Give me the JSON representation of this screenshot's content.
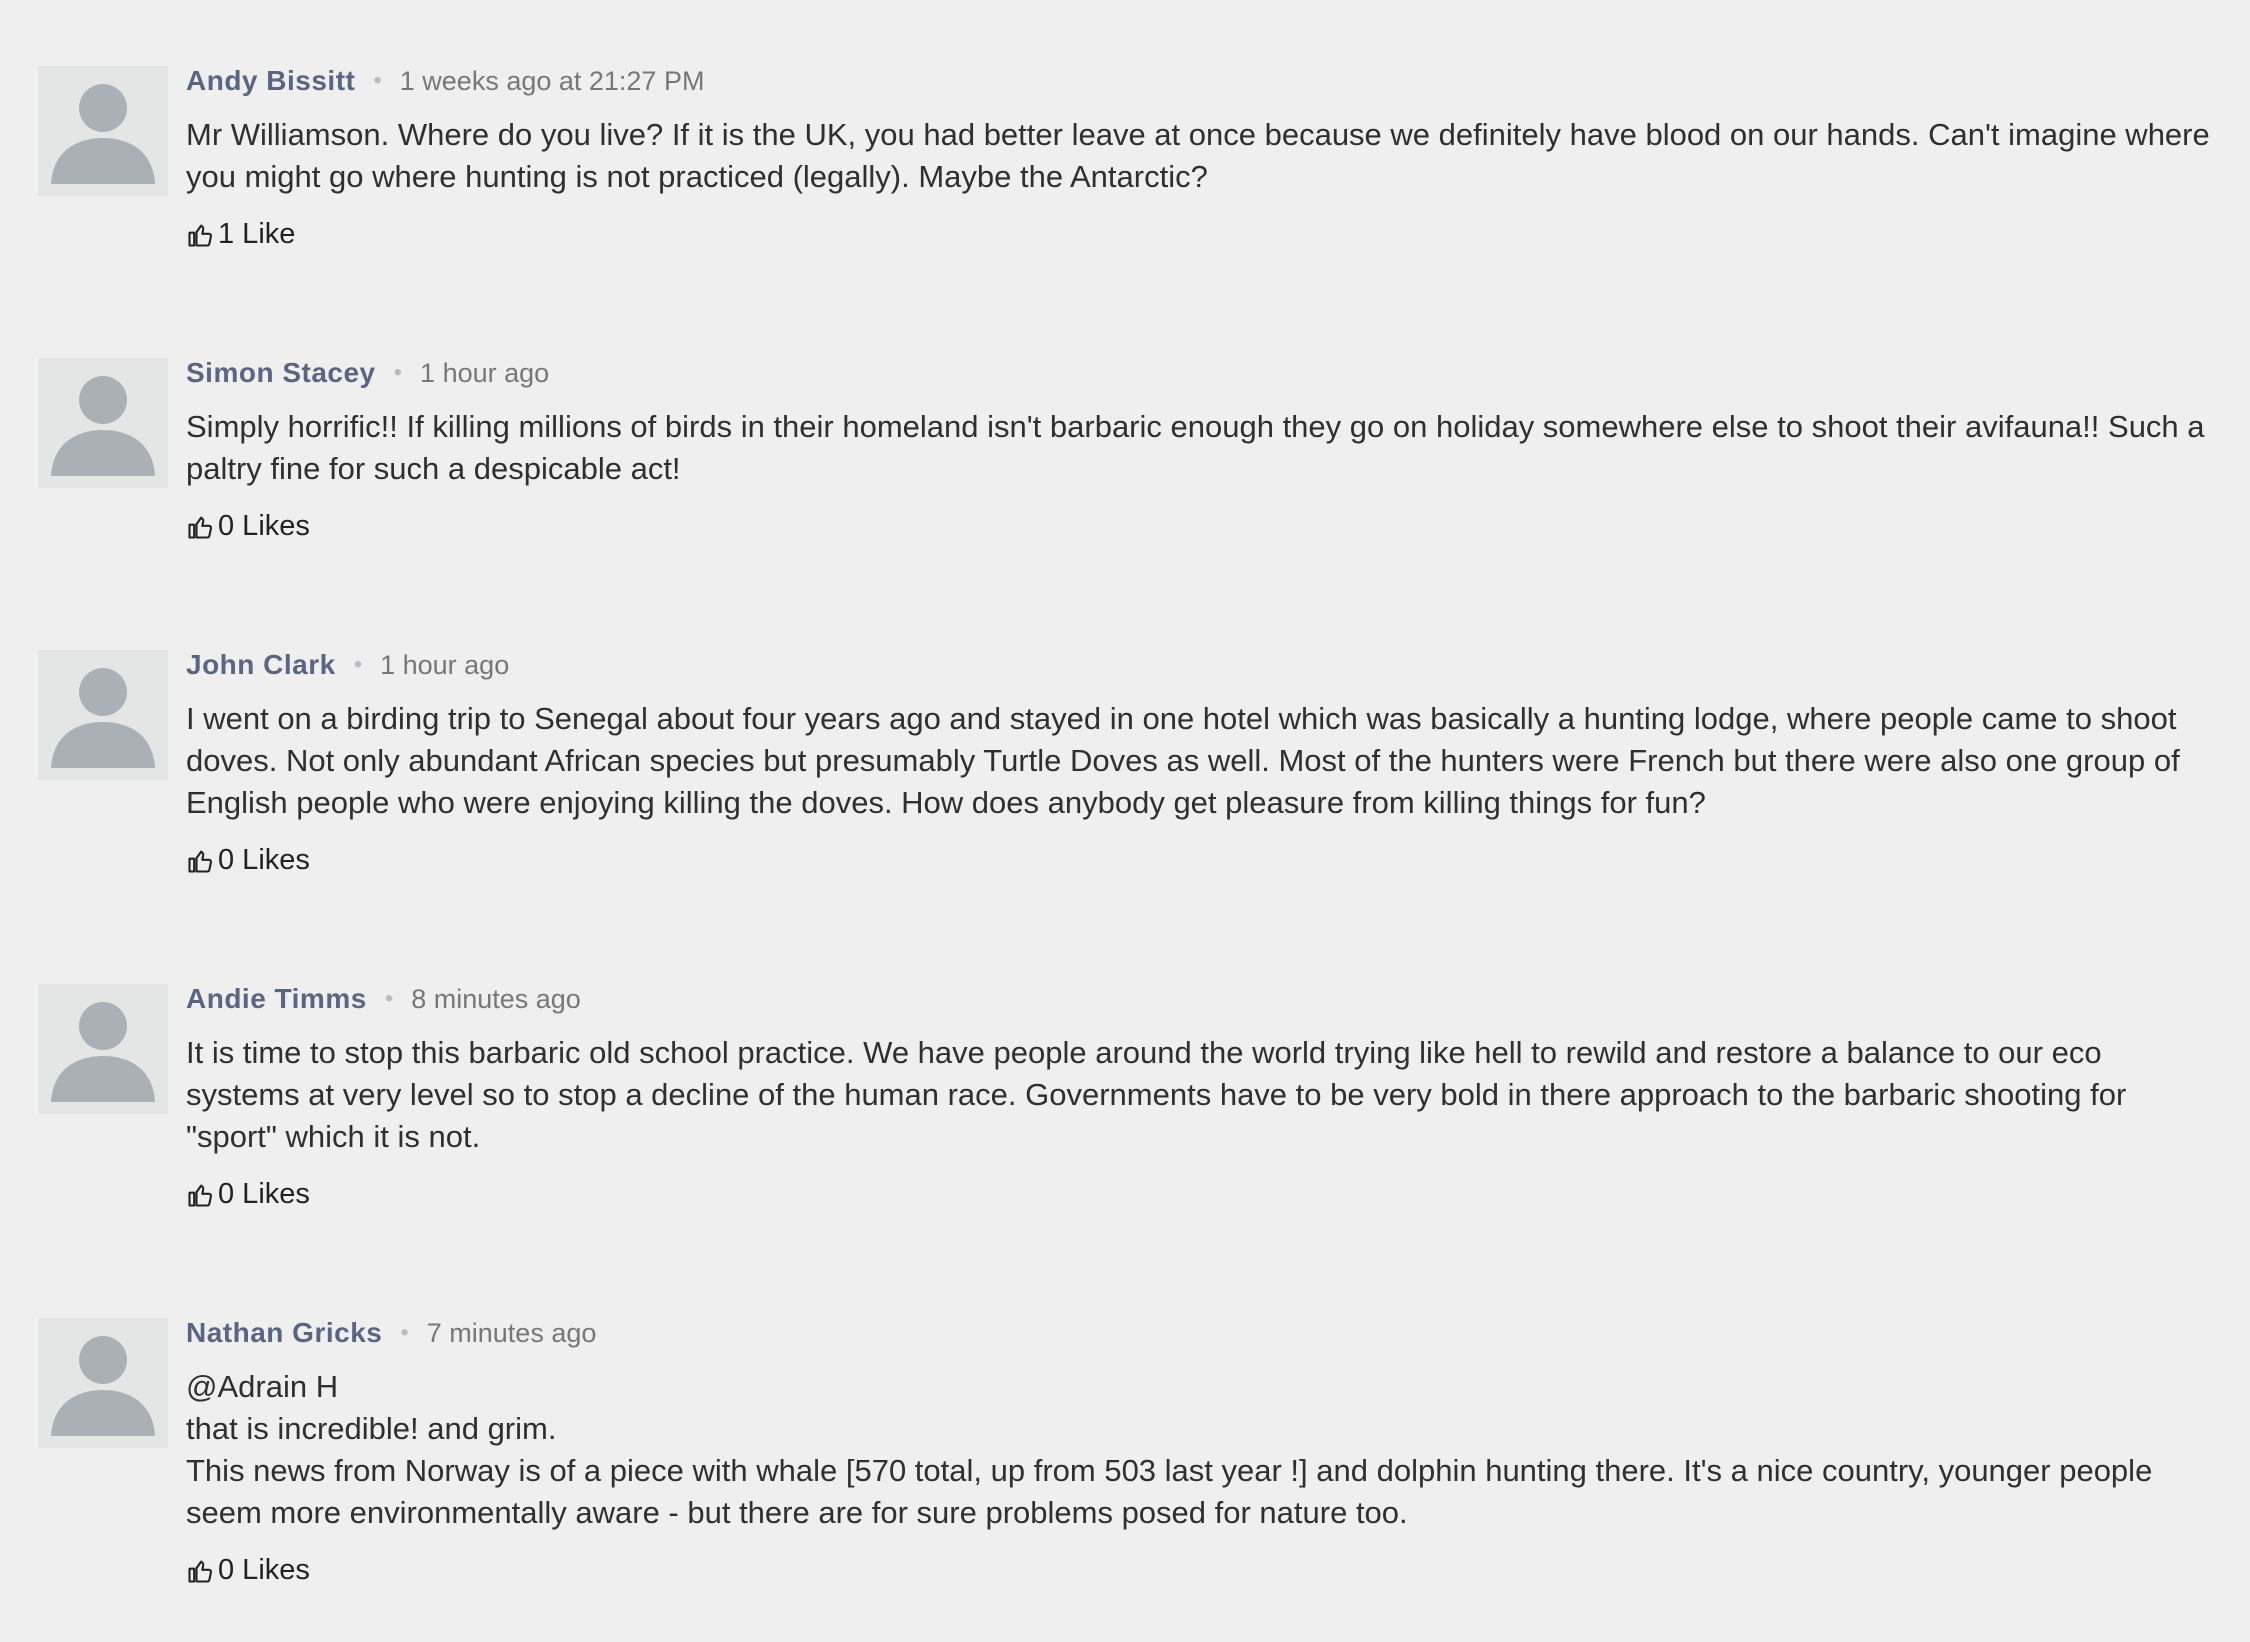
{
  "comments": [
    {
      "author": "Andy Bissitt",
      "separator": "•",
      "time": "1 weeks ago at 21:27 PM",
      "lines": [
        "Mr Williamson. Where do you live? If it is the UK, you had better leave at once because we definitely have blood on our hands. Can't imagine where you might go where  hunting is not practiced (legally). Maybe the Antarctic?"
      ],
      "likes": "1 Like"
    },
    {
      "author": "Simon Stacey",
      "separator": "•",
      "time": "1 hour ago",
      "lines": [
        "Simply horrific!! If killing millions of birds in their homeland isn't barbaric enough they go on holiday somewhere else to shoot their avifauna!! Such a paltry fine for such a despicable act!"
      ],
      "likes": "0 Likes"
    },
    {
      "author": "John Clark",
      "separator": "•",
      "time": "1 hour ago",
      "lines": [
        "I went on a birding trip to Senegal about four years ago and stayed in one hotel which was basically a hunting lodge, where people came to shoot doves. Not only abundant African species but presumably Turtle Doves as well. Most of the hunters were French but there were also one group of English people who were enjoying killing the doves. How does anybody get pleasure from killing things for fun?"
      ],
      "likes": "0 Likes"
    },
    {
      "author": "Andie Timms",
      "separator": "•",
      "time": "8 minutes ago",
      "lines": [
        "It is time to stop this barbaric old school practice. We have people around the world trying like hell to rewild and restore a balance to our eco systems at very level so to stop a decline of the human race. Governments have to be very bold in there approach to the barbaric shooting for \"sport\" which it is not."
      ],
      "likes": "0 Likes"
    },
    {
      "author": "Nathan Gricks",
      "separator": "•",
      "time": "7 minutes ago",
      "lines": [
        "@Adrain H",
        "that is incredible! and grim.",
        "This news from Norway is of a piece with whale [570 total, up from 503 last year !] and dolphin hunting there. It's a nice country, younger people seem more environmentally aware - but there are for sure problems posed for nature too."
      ],
      "likes": "0 Likes"
    }
  ]
}
